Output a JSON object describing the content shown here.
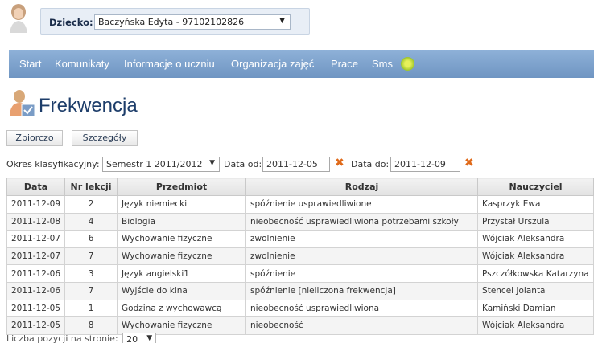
{
  "child_selector": {
    "label": "Dziecko:",
    "selected": "Baczyńska Edyta - 97102102826"
  },
  "nav": {
    "items": [
      "Start",
      "Komunikaty",
      "Informacje o uczniu",
      "Organizacja zajęć",
      "Prace",
      "Sms"
    ]
  },
  "page": {
    "title": "Frekwencja"
  },
  "tabs": [
    "Zbiorczo",
    "Szczegóły"
  ],
  "filters": {
    "period_label": "Okres klasyfikacyjny:",
    "period_value": "Semestr 1 2011/2012",
    "date_from_label": "Data od:",
    "date_from_value": "2011-12-05",
    "date_to_label": "Data do:",
    "date_to_value": "2011-12-09"
  },
  "table": {
    "headers": [
      "Data",
      "Nr lekcji",
      "Przedmiot",
      "Rodzaj",
      "Nauczyciel"
    ],
    "rows": [
      [
        "2011-12-09",
        "2",
        "Język niemiecki",
        "spóźnienie usprawiedliwione",
        "Kasprzyk Ewa"
      ],
      [
        "2011-12-08",
        "4",
        "Biologia",
        "nieobecność usprawiedliwiona potrzebami szkoły",
        "Przystał Urszula"
      ],
      [
        "2011-12-07",
        "6",
        "Wychowanie fizyczne",
        "zwolnienie",
        "Wójciak Aleksandra"
      ],
      [
        "2011-12-07",
        "7",
        "Wychowanie fizyczne",
        "zwolnienie",
        "Wójciak Aleksandra"
      ],
      [
        "2011-12-06",
        "3",
        "Język angielski1",
        "spóźnienie",
        "Pszczółkowska Katarzyna"
      ],
      [
        "2011-12-06",
        "7",
        "Wyjście do kina",
        "spóźnienie [nieliczona frekwencja]",
        "Stencel Jolanta"
      ],
      [
        "2011-12-05",
        "1",
        "Godzina z wychowawcą",
        "nieobecność usprawiedliwiona",
        "Kamiński Damian"
      ],
      [
        "2011-12-05",
        "8",
        "Wychowanie fizyczne",
        "nieobecność",
        "Wójciak Aleksandra"
      ]
    ]
  },
  "footer": {
    "page_size_label": "Liczba pozycji na stronie:",
    "page_size_value": "20"
  },
  "colors": {
    "nav_bg": "#7aa0cb",
    "title": "#1d3d6a",
    "clear_icon": "#e06a1a"
  }
}
